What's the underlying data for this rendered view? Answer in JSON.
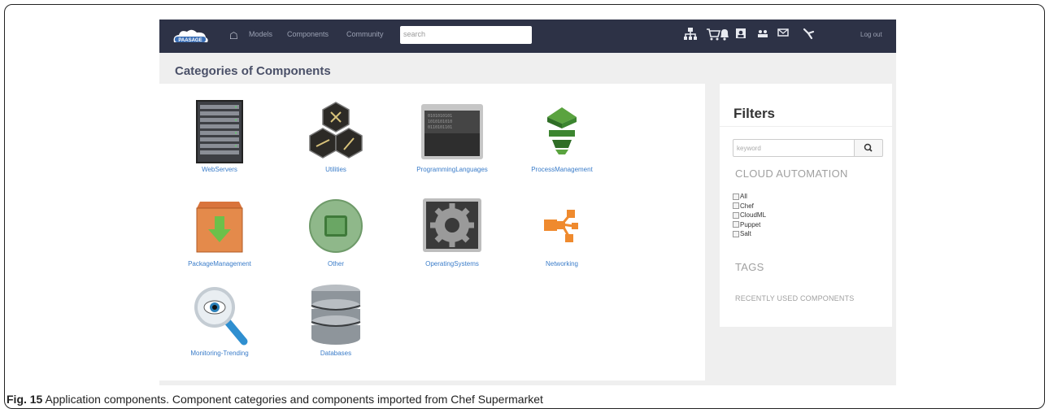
{
  "navbar": {
    "logo_text": "PAASAGE",
    "links": [
      "Models",
      "Components",
      "Community"
    ],
    "search_placeholder": "search",
    "logout_label": "Log out",
    "icons": [
      "sitemap-icon",
      "cart-icon",
      "bell-icon",
      "id-card-icon",
      "users-icon",
      "envelope-icon",
      "wrench-icon"
    ]
  },
  "page": {
    "title": "Categories of Components"
  },
  "categories": [
    {
      "label": "WebServers",
      "icon": "server-rack-icon"
    },
    {
      "label": "Utilities",
      "icon": "hexagon-tools-icon"
    },
    {
      "label": "ProgrammingLanguages",
      "icon": "binary-screen-icon"
    },
    {
      "label": "ProcessManagement",
      "icon": "layers-stack-icon"
    },
    {
      "label": "PackageManagement",
      "icon": "package-download-icon"
    },
    {
      "label": "Other",
      "icon": "circle-square-icon"
    },
    {
      "label": "OperatingSystems",
      "icon": "gear-os-icon"
    },
    {
      "label": "Networking",
      "icon": "network-nodes-icon"
    },
    {
      "label": "Monitoring-Trending",
      "icon": "magnifier-eye-icon"
    },
    {
      "label": "Databases",
      "icon": "database-icon"
    }
  ],
  "filters": {
    "title": "Filters",
    "keyword_placeholder": "keyword",
    "cloud_automation_title": "CLOUD AUTOMATION",
    "options": [
      "All",
      "Chef",
      "CloudML",
      "Puppet",
      "Salt"
    ],
    "tags_title": "TAGS",
    "recent_title": "RECENTLY USED COMPONENTS"
  },
  "caption": {
    "label": "Fig. 15",
    "text": " Application components. Component categories and components imported from Chef Supermarket"
  },
  "colors": {
    "navbar": "#2d3246",
    "link": "#3a7cc9",
    "page_bg": "#efefef",
    "section_heading": "#a0a0a0"
  }
}
